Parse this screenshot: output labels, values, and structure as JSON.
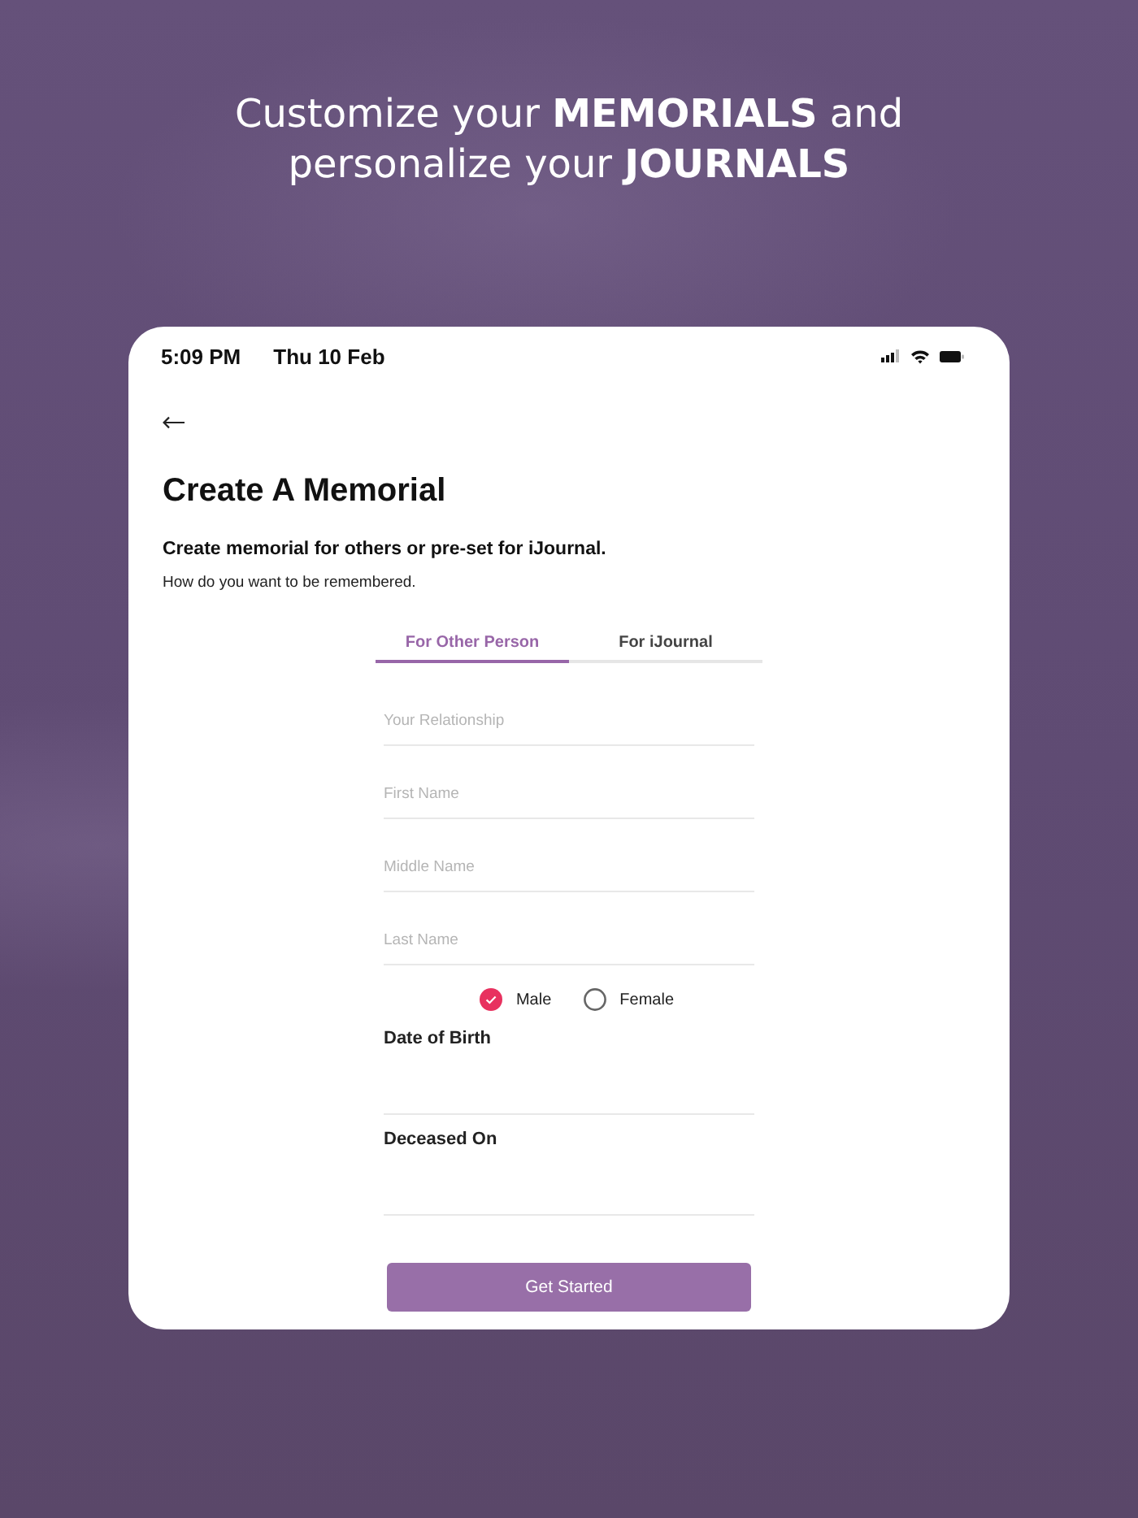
{
  "headline": "Customize your **MEMORIALS** and personalize your **JOURNALS**",
  "status_bar": {
    "time": "5:09 PM",
    "date": "Thu 10 Feb"
  },
  "title": "Create A Memorial",
  "subtitle": "Create memorial for others or pre-set for iJournal.",
  "prompt": "How do you want to be remembered.",
  "tabs": [
    {
      "label": "For Other Person",
      "selected": true
    },
    {
      "label": "For iJournal",
      "selected": false
    }
  ],
  "fields": [
    {
      "placeholder": "Your Relationship"
    },
    {
      "placeholder": "First Name"
    },
    {
      "placeholder": "Middle Name"
    },
    {
      "placeholder": "Last Name"
    }
  ],
  "gender_options": [
    {
      "label": "Male",
      "selected": true
    },
    {
      "label": "Female",
      "selected": false
    }
  ],
  "date_fields": [
    {
      "label": "Date of Birth"
    },
    {
      "label": "Deceased On"
    }
  ],
  "button": "Get Started"
}
